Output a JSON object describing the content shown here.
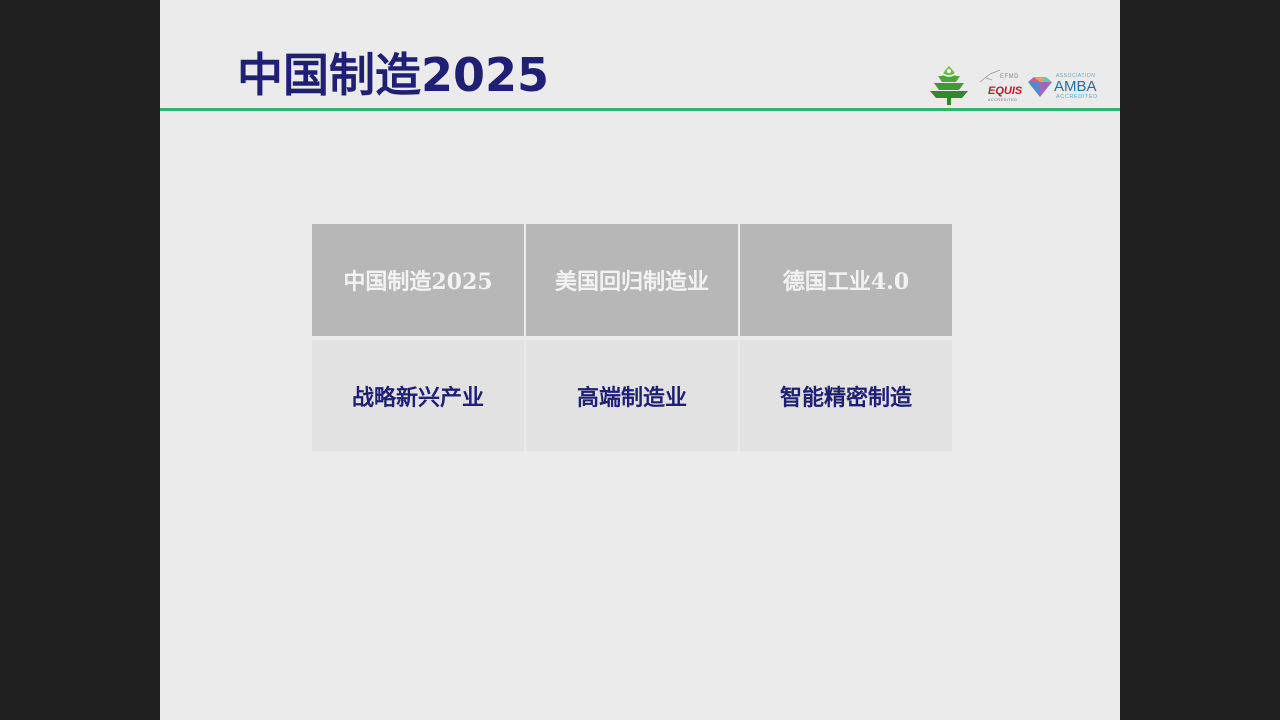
{
  "slide": {
    "title": "中国制造2025"
  },
  "logos": {
    "equis_org": "EFMD",
    "equis_name": "EQUIS",
    "equis_status": "ACCREDITED",
    "amba_assoc": "ASSOCIATION",
    "amba_name": "AMBA",
    "amba_status": "ACCREDITED"
  },
  "table": {
    "headers": [
      "中国制造2025",
      "美国回归制造业",
      "德国工业4.0"
    ],
    "row": [
      "战略新兴产业",
      "高端制造业",
      "智能精密制造"
    ]
  },
  "colors": {
    "title": "#1f1f73",
    "rule": "#33b36b",
    "header_bg": "#b7b7b7",
    "body_bg": "#e2e2e2",
    "slide_bg": "#ebebeb",
    "frame_bg": "#1f1f1f"
  }
}
